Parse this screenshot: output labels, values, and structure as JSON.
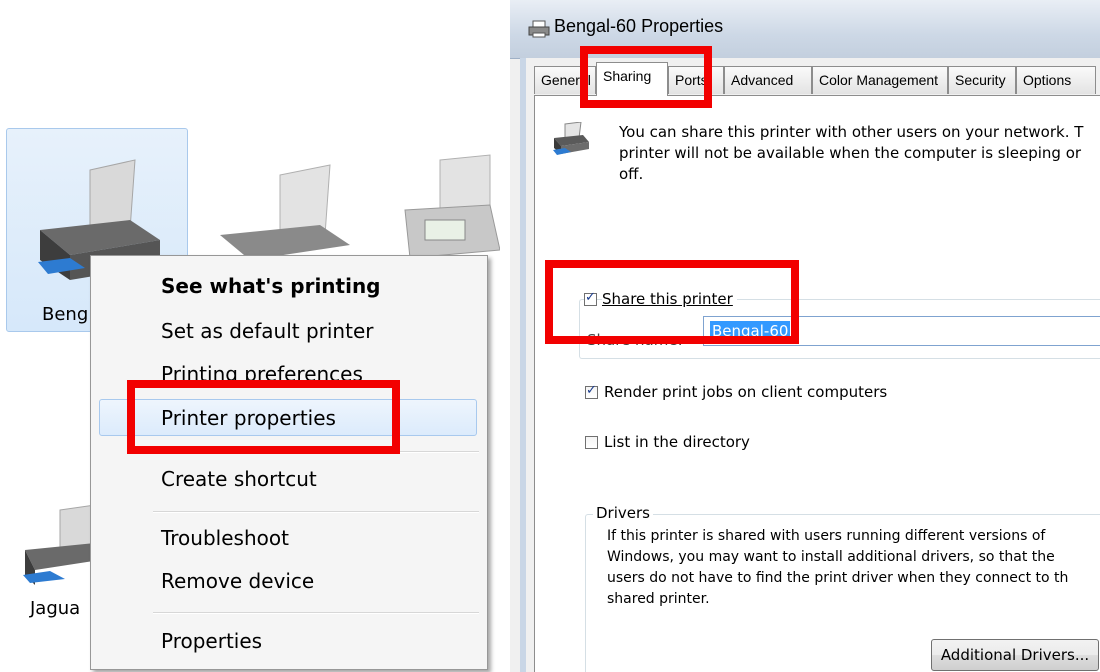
{
  "explorer": {
    "device_1_label": "Beng",
    "device_2_label": "Jagua",
    "bottom_partial_text": "Bengal-60"
  },
  "context_menu": {
    "items": [
      {
        "label": "See what's printing",
        "bold": true
      },
      {
        "label": "Set as default printer",
        "bold": false
      },
      {
        "label": "Printing preferences",
        "bold": false
      },
      {
        "label": "Printer properties",
        "bold": false
      },
      {
        "label": "Create shortcut",
        "bold": false
      },
      {
        "label": "Troubleshoot",
        "bold": false
      },
      {
        "label": "Remove device",
        "bold": false
      },
      {
        "label": "Properties",
        "bold": false
      }
    ],
    "highlighted_index": 3
  },
  "dialog": {
    "title": "Bengal-60 Properties",
    "tabs": [
      {
        "label": "General",
        "active": false
      },
      {
        "label": "Sharing",
        "active": true
      },
      {
        "label": "Ports",
        "active": false
      },
      {
        "label": "Advanced",
        "active": false
      },
      {
        "label": "Color Management",
        "active": false
      },
      {
        "label": "Security",
        "active": false
      },
      {
        "label": "Options",
        "active": false
      }
    ],
    "info_lines": [
      "You can share this printer with other users on your network. T",
      "printer will not be available when the computer is sleeping or",
      "off."
    ],
    "share_checkbox": {
      "label": "Share this printer",
      "checked": true
    },
    "share_name_label": "Share name:",
    "share_name_value": "Bengal-60",
    "render_checkbox": {
      "label": "Render print jobs on client computers",
      "checked": true
    },
    "list_checkbox": {
      "label": "List in the directory",
      "checked": false
    },
    "drivers_group": {
      "title": "Drivers",
      "lines": [
        "If this printer is shared with users running different versions of",
        "Windows, you may want to install additional drivers, so that the",
        "users do not have to find the print driver when they connect to th",
        "shared printer."
      ],
      "button_label": "Additional Drivers..."
    }
  },
  "colors": {
    "highlight_red": "#f20000",
    "selection_blue": "#3399ff"
  }
}
